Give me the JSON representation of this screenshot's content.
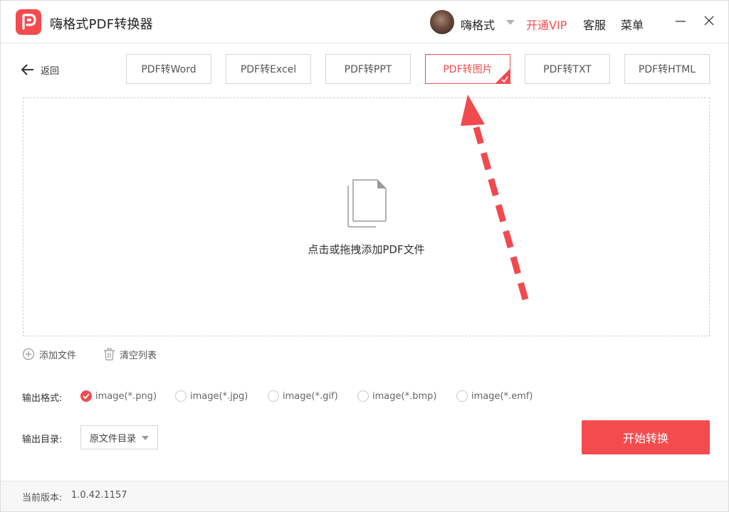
{
  "app": {
    "title": "嗨格式PDF转换器",
    "icon": "pdf-logo-icon",
    "accent_color": "#f44b4f"
  },
  "header": {
    "username": "嗨格式",
    "vip_label": "开通VIP",
    "service_label": "客服",
    "menu_label": "菜单"
  },
  "nav": {
    "back_label": "返回"
  },
  "tabs": [
    {
      "label": "PDF转Word",
      "active": false
    },
    {
      "label": "PDF转Excel",
      "active": false
    },
    {
      "label": "PDF转PPT",
      "active": false
    },
    {
      "label": "PDF转图片",
      "active": true
    },
    {
      "label": "PDF转TXT",
      "active": false
    },
    {
      "label": "PDF转HTML",
      "active": false
    }
  ],
  "dropzone": {
    "text": "点击或拖拽添加PDF文件",
    "icon": "documents-icon"
  },
  "list_actions": {
    "add_label": "添加文件",
    "clear_label": "清空列表"
  },
  "output_format": {
    "label": "输出格式:",
    "options": [
      {
        "label": "image(*.png)",
        "checked": true
      },
      {
        "label": "image(*.jpg)",
        "checked": false
      },
      {
        "label": "image(*.gif)",
        "checked": false
      },
      {
        "label": "image(*.bmp)",
        "checked": false
      },
      {
        "label": "image(*.emf)",
        "checked": false
      }
    ]
  },
  "output_dir": {
    "label": "输出目录:",
    "selected": "原文件目录"
  },
  "start_button": "开始转换",
  "footer": {
    "version_label": "当前版本:",
    "version": "1.0.42.1157"
  }
}
